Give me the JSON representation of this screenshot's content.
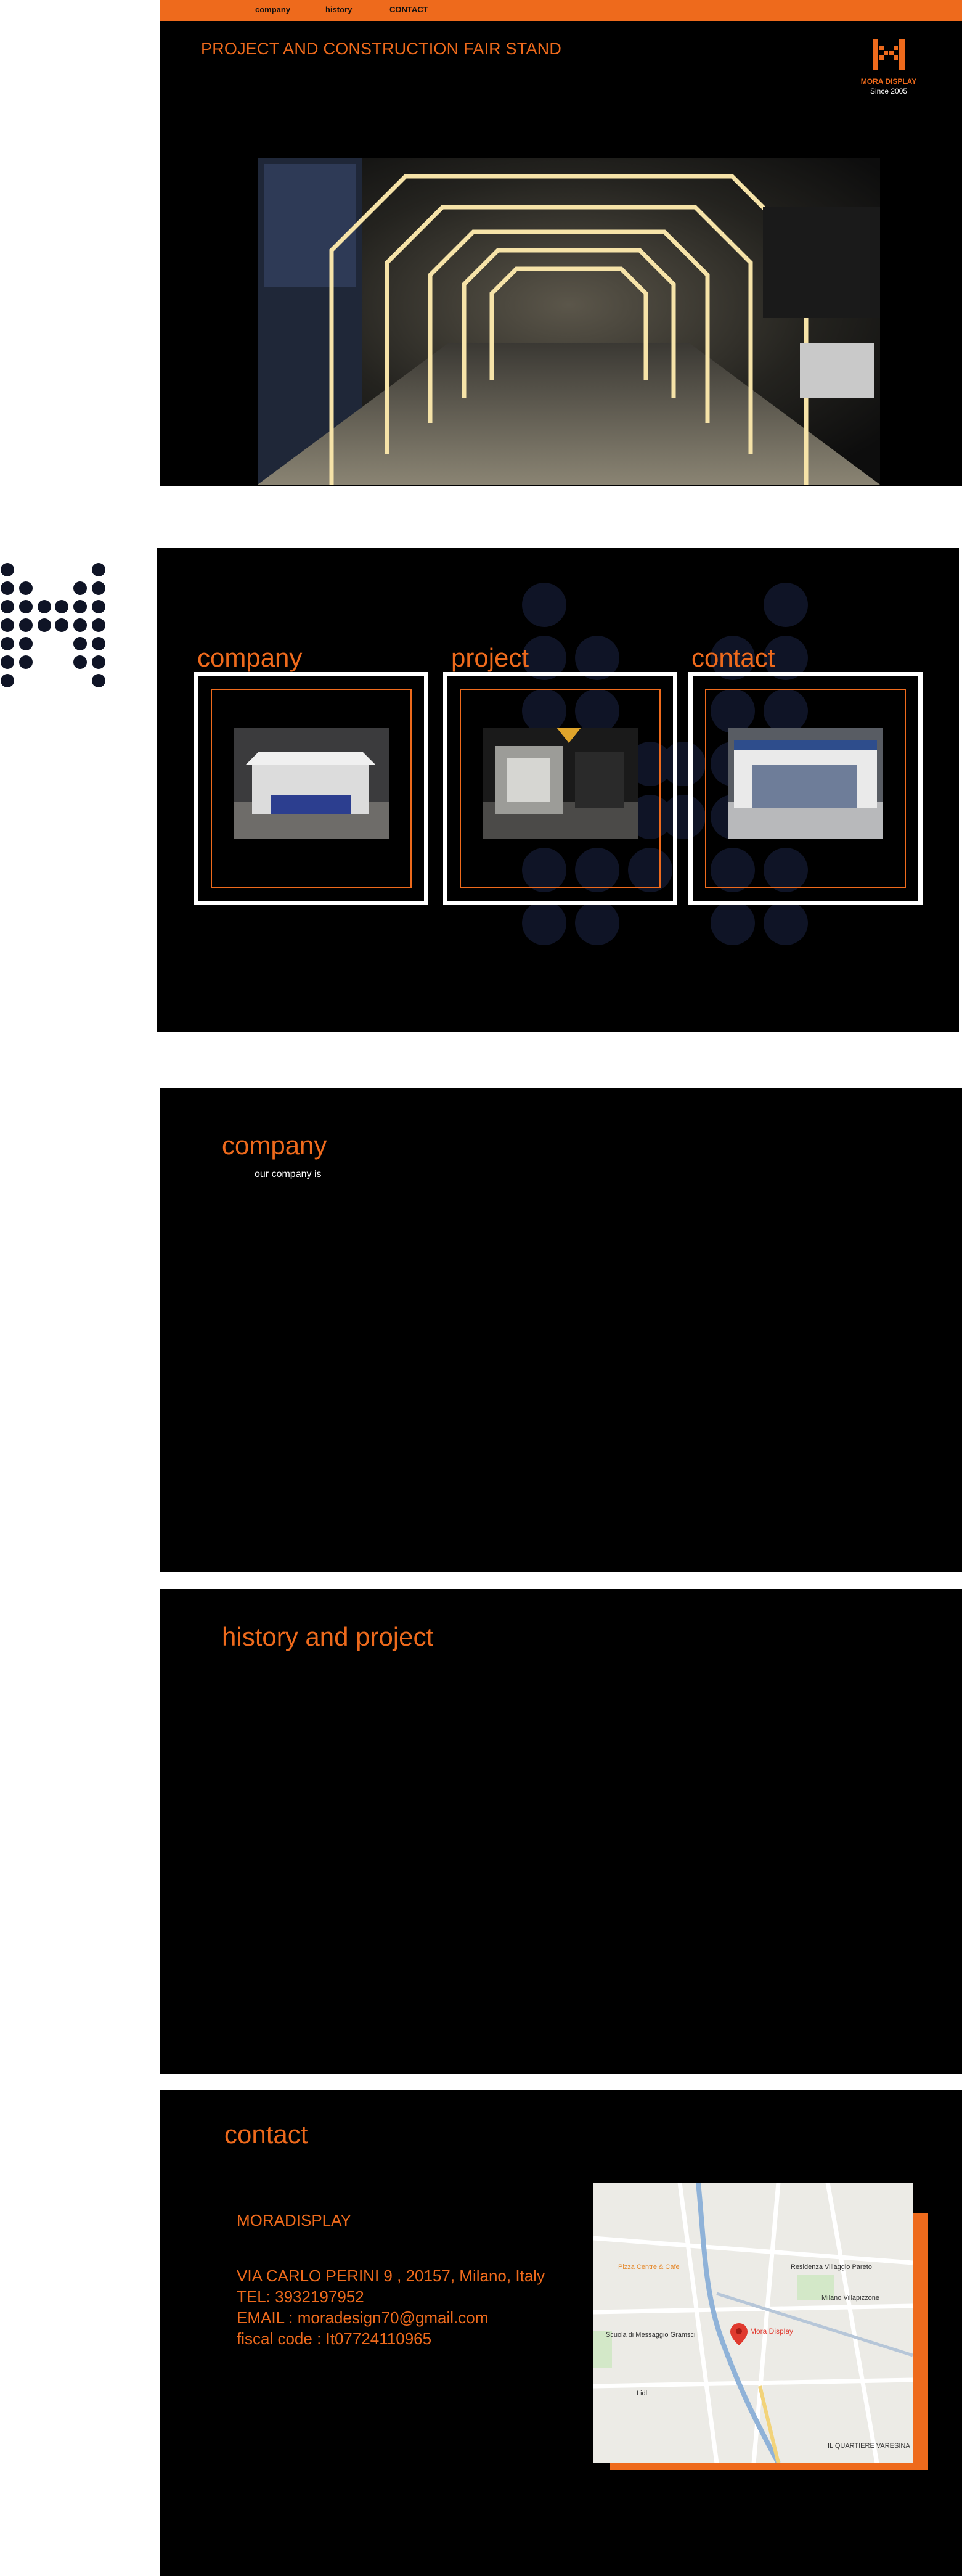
{
  "nav": {
    "items": [
      {
        "label": "company"
      },
      {
        "label": "history"
      },
      {
        "label": "CONTACT"
      }
    ]
  },
  "hero": {
    "title": "PROJECT AND CONSTRUCTION FAIR STAND",
    "logo_name": "MORA DISPLAY",
    "logo_since": "Since 2005"
  },
  "gallery": {
    "cards": [
      {
        "title": "company"
      },
      {
        "title": "project"
      },
      {
        "title": "contact"
      }
    ]
  },
  "company": {
    "title": "company",
    "text": "our company is"
  },
  "history": {
    "title": "history and project"
  },
  "contact": {
    "title": "contact",
    "name": "MORADISPLAY",
    "address": "VIA CARLO PERINI 9 , 20157, Milano, Italy",
    "tel": "TEL: 3932197952",
    "email": "EMAIL : moradesign70@gmail.com",
    "fiscal": "fiscal code : It07724110965",
    "map_labels": {
      "pin": "Mora Display",
      "place1": "Residenza Villaggio Pareto",
      "place2": "Milano Villapizzone",
      "place3": "Scuola di Messaggio Gramsci",
      "place4": "IL QUARTIERE VARESINA",
      "place5": "Pizza Centre & Cafe",
      "place6": "Lidl"
    }
  },
  "colors": {
    "accent": "#ee6a1c",
    "background": "#000000",
    "dots": "#0f1426"
  }
}
